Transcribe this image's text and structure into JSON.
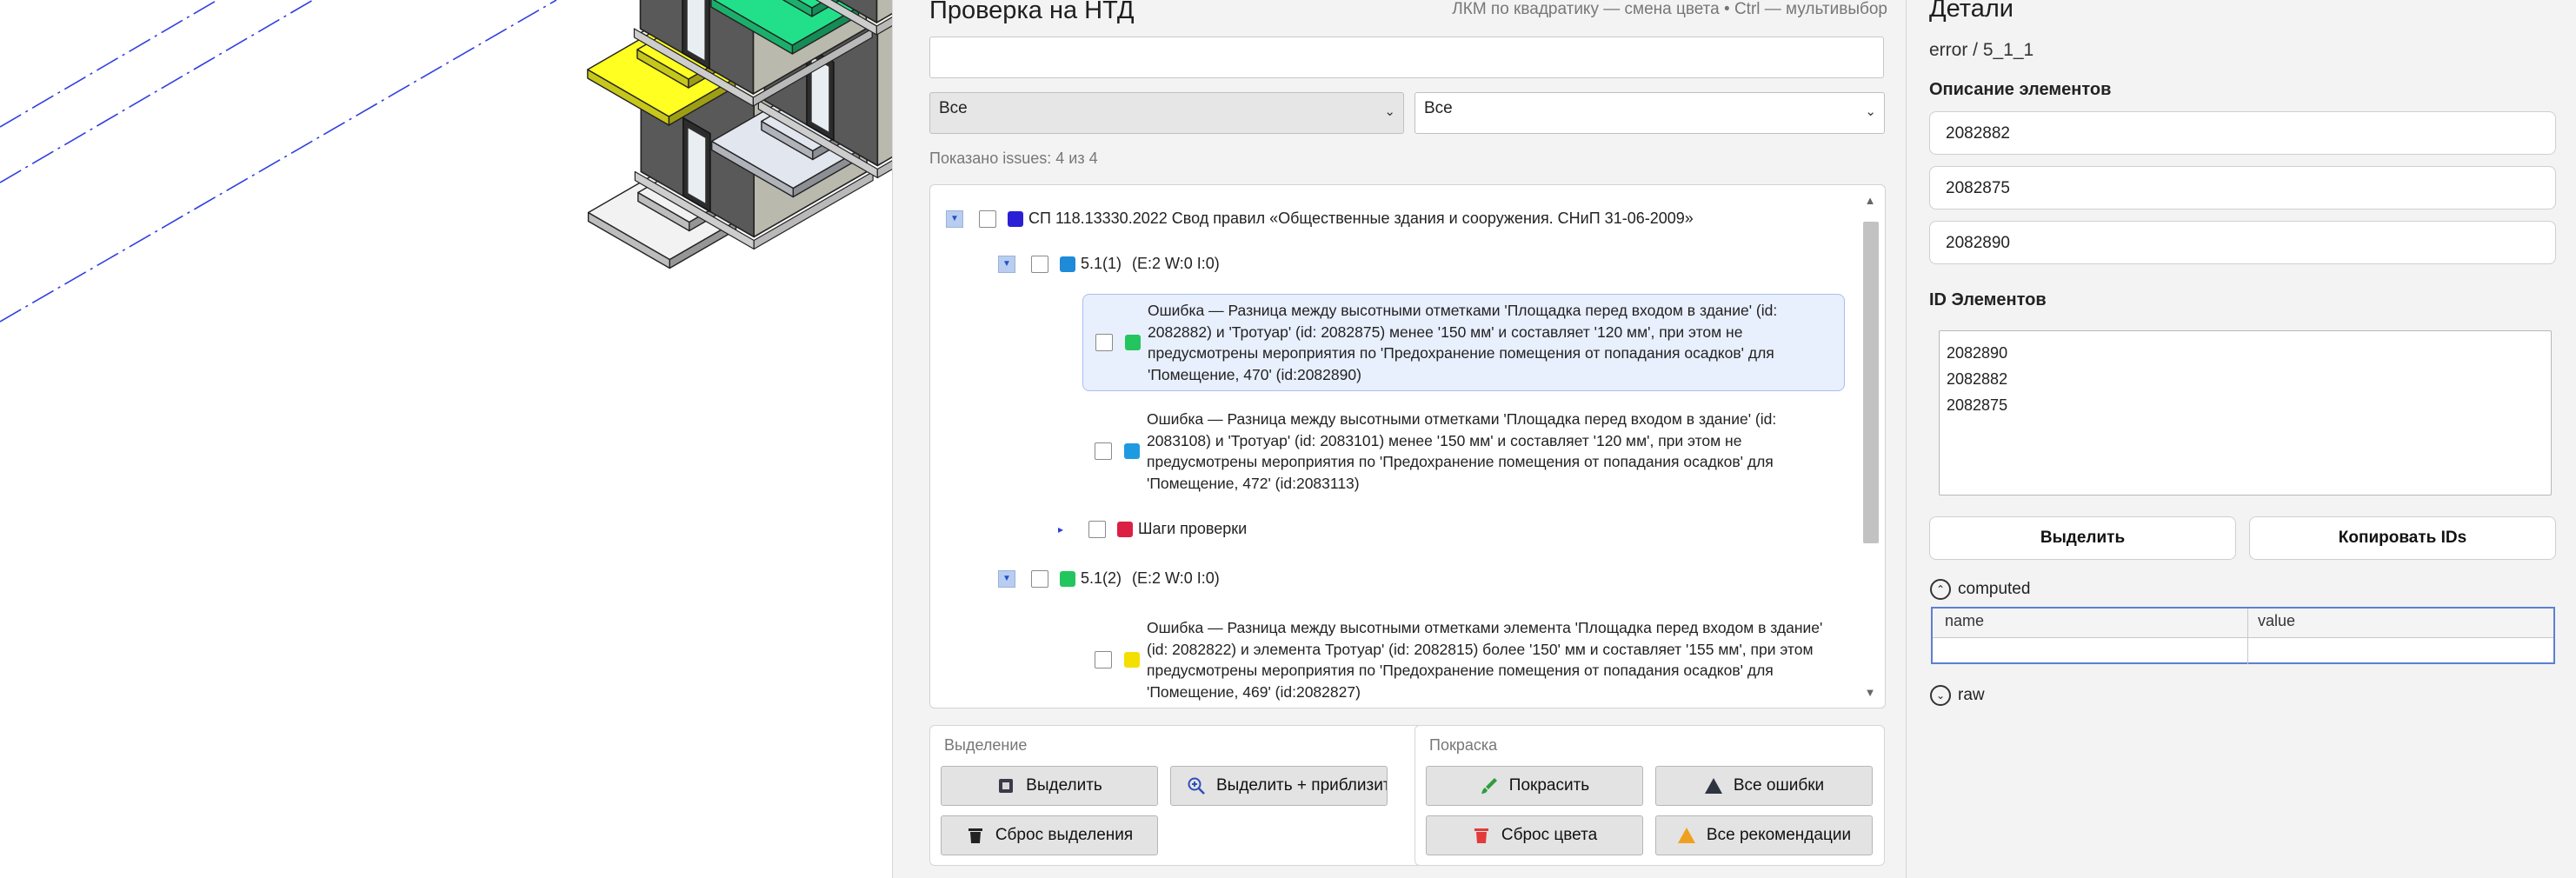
{
  "check_panel": {
    "title": "Проверка на НТД",
    "hint": "ЛКМ по квадратику — смена цвета • Ctrl — мультивыбор",
    "search": {
      "value": "",
      "placeholder": ""
    },
    "filter_left": "Все",
    "filter_right": "Все",
    "shown_count": "Показано issues: 4 из 4",
    "tree": {
      "root": {
        "label": "СП 118.13330.2022 Свод правил «Общественные здания и сооружения. СНиП 31-06-2009»",
        "color": "#2b1fd6"
      },
      "group1": {
        "label": "5.1(1)",
        "stats": "(E:2   W:0   I:0)",
        "color": "#1e8ad8"
      },
      "issue1": {
        "text": "Ошибка — Разница между высотными отметками 'Площадка перед входом в здание' (id: 2082882) и 'Тротуар' (id: 2082875) менее '150 мм' и составляет '120 мм', при этом не предусмотрены мероприятия по 'Предохранение помещения от попадания осадков' для 'Помещение, 470'  (id:2082890)",
        "color": "#22c55e"
      },
      "issue2": {
        "text": "Ошибка — Разница между высотными отметками 'Площадка перед входом в здание' (id: 2083108) и 'Тротуар' (id: 2083101) менее '150 мм' и составляет '120 мм', при этом не предусмотрены мероприятия по 'Предохранение помещения от попадания осадков' для 'Помещение, 472'  (id:2083113)",
        "color": "#1e9be0"
      },
      "steps": {
        "label": "Шаги проверки",
        "color": "#dc2043"
      },
      "group2": {
        "label": "5.1(2)",
        "stats": "(E:2   W:0   I:0)",
        "color": "#22c55e"
      },
      "issue3": {
        "text": "Ошибка — Разница между высотными отметками элемента 'Площадка перед входом в здание' (id: 2082822) и элемента Тротуар' (id: 2082815) более '150' мм и составляет '155 мм', при этом предусмотрены мероприятия по 'Предохранение помещения от попадания осадков' для 'Помещение, 469'  (id:2082827)",
        "color": "#f4e000"
      }
    },
    "selection_group": {
      "title": "Выделение",
      "select": "Выделить",
      "select_zoom": "Выделить + приблизить",
      "reset_select": "Сброс выделения"
    },
    "paint_group": {
      "title": "Покраска",
      "paint": "Покрасить",
      "all_errors": "Все ошибки",
      "reset_color": "Сброс цвета",
      "all_recs": "Все рекомендации"
    }
  },
  "details": {
    "title": "Детали",
    "subtitle": "error / 5_1_1",
    "desc_label": "Описание элементов",
    "elements": [
      "2082882",
      "2082875",
      "2082890"
    ],
    "ids_label": "ID Элементов",
    "ids_text": "2082890\n2082882\n2082875",
    "select_btn": "Выделить",
    "copy_btn": "Копировать IDs",
    "computed_label": "computed",
    "table_headers": [
      "name",
      "value"
    ],
    "raw_label": "raw"
  },
  "icons": {
    "select": "square-select-icon",
    "zoom": "magnifier-plus-icon",
    "reset": "trash-icon",
    "paint": "brush-icon",
    "errors": "triangle-dark-icon",
    "recs": "triangle-orange-icon"
  }
}
